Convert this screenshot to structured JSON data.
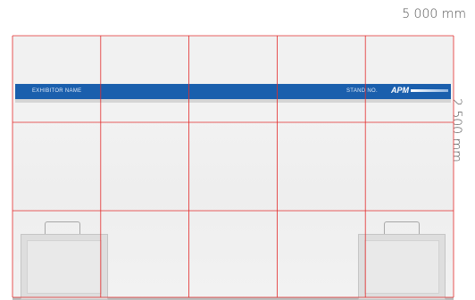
{
  "dimensions": {
    "width_label": "5 000 mm",
    "height_label": "2 500 mm"
  },
  "fascia": {
    "exhibitor_label": "EXHIBITOR NAME",
    "stand_label": "STAND NO.",
    "logo_text": "APM",
    "color": "#1a5fad"
  },
  "grid": {
    "columns": 5,
    "rows": 3,
    "color": "#e32b2b"
  }
}
